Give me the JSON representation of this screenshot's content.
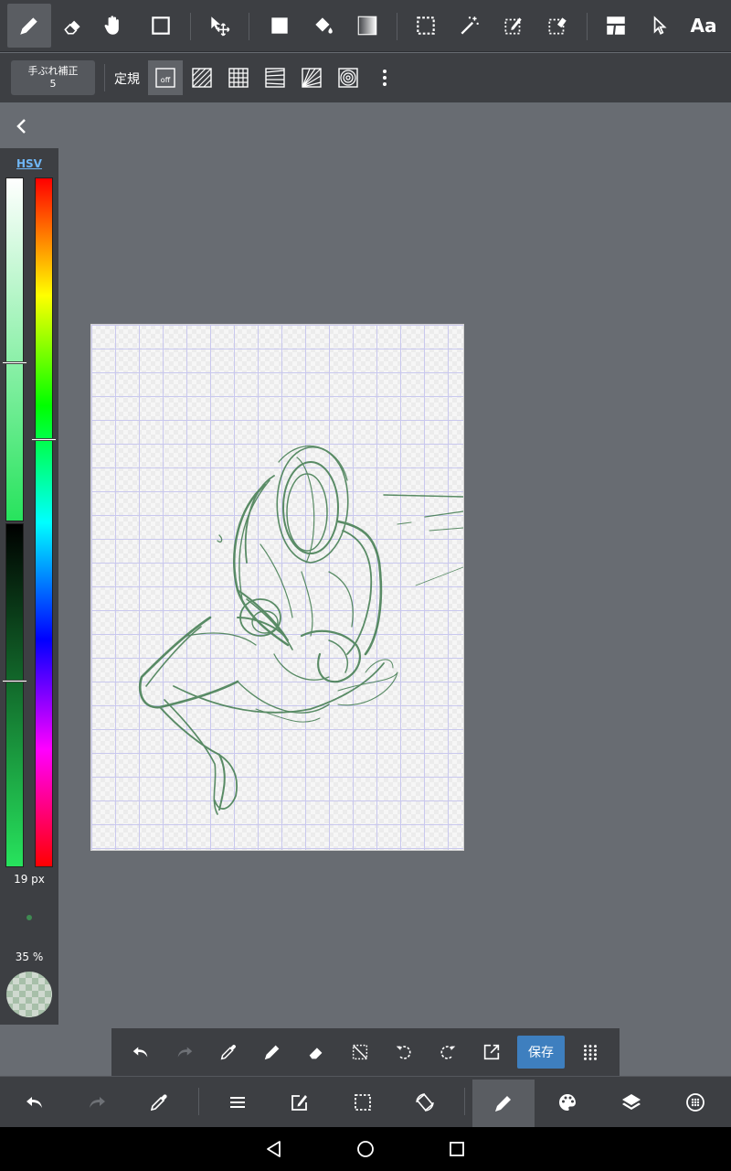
{
  "colors": {
    "panel_bg": "#3d3f43",
    "workspace_bg": "#686c72",
    "stroke_color": "#3f7a4d",
    "accent_blue": "#3e7fbf",
    "hsv_link": "#6fb6f5"
  },
  "toolbar": {
    "tools": [
      {
        "name": "pen-tool",
        "icon": "pen-icon"
      },
      {
        "name": "eraser-tool",
        "icon": "eraser-icon"
      },
      {
        "name": "hand-tool",
        "icon": "hand-icon"
      },
      {
        "name": "shape-tool",
        "icon": "square-outline-icon"
      },
      {
        "name": "move-tool",
        "icon": "move-icon"
      },
      {
        "name": "fill-rect-tool",
        "icon": "filled-square-icon"
      },
      {
        "name": "bucket-tool",
        "icon": "bucket-icon"
      },
      {
        "name": "gradient-tool",
        "icon": "gradient-icon"
      },
      {
        "name": "select-rect-tool",
        "icon": "selection-icon"
      },
      {
        "name": "magic-wand-tool",
        "icon": "magic-wand-icon"
      },
      {
        "name": "select-pen-tool",
        "icon": "select-pen-icon"
      },
      {
        "name": "select-eraser-tool",
        "icon": "select-eraser-icon"
      },
      {
        "name": "frame-tool",
        "icon": "frame-divider-icon"
      },
      {
        "name": "operation-tool",
        "icon": "pointer-icon"
      }
    ],
    "text_tool_label": "Aa"
  },
  "subtoolbar": {
    "stabilizer_label": "手ぶれ補正",
    "stabilizer_value": "5",
    "ruler_label": "定規",
    "ruler_off_label": "off",
    "rulers": [
      "ruler-off-icon",
      "ruler-parallel-icon",
      "ruler-grid-icon",
      "ruler-perspective-icon",
      "ruler-radial-icon",
      "ruler-concentric-icon"
    ]
  },
  "color_panel": {
    "mode_label": "HSV",
    "brush_size": "19 px",
    "opacity": "35 %",
    "saturation": 0.54,
    "value": 0.46,
    "hue": 0.38
  },
  "quick_bar": {
    "save_label": "保存",
    "buttons": [
      "undo-icon",
      "redo-icon",
      "eyedropper-icon",
      "pen-icon",
      "eraser-icon",
      "deselect-icon",
      "rotate-left-icon",
      "rotate-right-icon",
      "export-icon",
      "grid-dots-icon"
    ]
  },
  "bottom_bar": {
    "buttons": [
      "undo-icon",
      "redo-icon",
      "eyedropper-icon",
      "menu-icon",
      "edit-icon",
      "selection-icon",
      "rotate-canvas-icon",
      "brush-icon",
      "palette-icon",
      "layers-icon",
      "material-icon"
    ]
  },
  "nav": [
    "back-icon",
    "home-icon",
    "recents-icon"
  ]
}
